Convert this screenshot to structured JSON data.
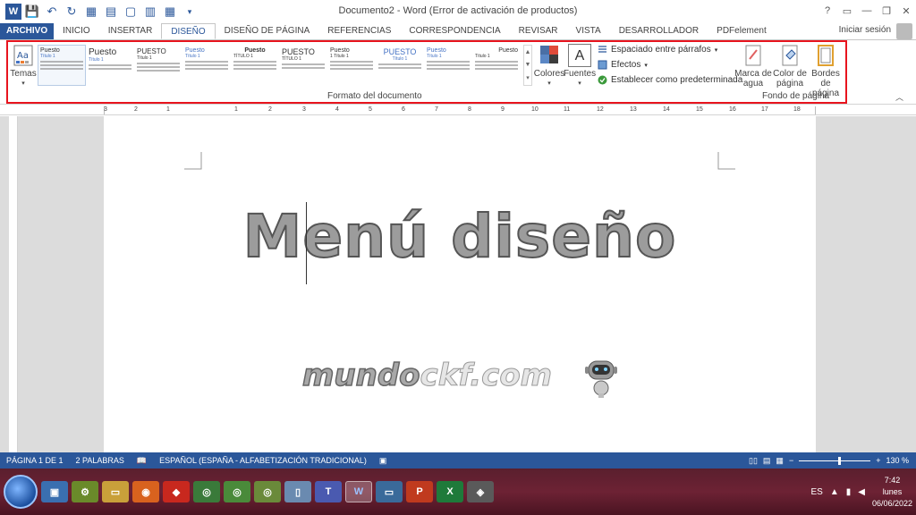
{
  "titlebar": {
    "doc_title": "Documento2 - Word (Error de activación de productos)",
    "help": "?",
    "controls": [
      "▭",
      "—",
      "❐",
      "✕"
    ]
  },
  "tabs": [
    "ARCHIVO",
    "INICIO",
    "INSERTAR",
    "DISEÑO",
    "DISEÑO DE PÁGINA",
    "REFERENCIAS",
    "CORRESPONDENCIA",
    "REVISAR",
    "VISTA",
    "DESARROLLADOR",
    "PDFelement"
  ],
  "active_tab": "DISEÑO",
  "signin": "Iniciar sesión",
  "ribbon": {
    "temas_label": "Temas",
    "style_thumbnails": [
      {
        "title": "Puesto",
        "heading": "Título 1"
      },
      {
        "title": "Puesto",
        "heading": "Título 1"
      },
      {
        "title": "PUESTO",
        "heading": "Título 1"
      },
      {
        "title": "Puesto",
        "heading": "Título 1"
      },
      {
        "title": "Puesto",
        "heading": "TÍTULO 1"
      },
      {
        "title": "PUESTO",
        "heading": "TÍTULO 1"
      },
      {
        "title": "Puesto",
        "heading": "1 Título 1"
      },
      {
        "title": "PUESTO",
        "heading": "Título 1"
      },
      {
        "title": "Puesto",
        "heading": "Título 1"
      },
      {
        "title": "Puesto",
        "heading": "Título 1"
      }
    ],
    "group_formato": "Formato del documento",
    "colores": "Colores",
    "fuentes": "Fuentes",
    "fuentes_glyph": "A",
    "espaciado": "Espaciado entre párrafos",
    "efectos": "Efectos",
    "establecer": "Establecer como predeterminada",
    "marca_de_agua": "Marca de agua",
    "color_de_pagina": "Color de página",
    "bordes_de_pagina": "Bordes de página",
    "group_fondo": "Fondo de página"
  },
  "ruler": {
    "numbers": [
      "3",
      "2",
      "1",
      "1",
      "2",
      "3",
      "4",
      "5",
      "6",
      "7",
      "8",
      "9",
      "10",
      "11",
      "12",
      "13",
      "14",
      "15",
      "16",
      "17",
      "18"
    ]
  },
  "document": {
    "title_text": "Menú diseño",
    "watermark_text_a": "mundo",
    "watermark_text_b": "ckf",
    "watermark_text_c": ".com"
  },
  "statusbar": {
    "page": "PÁGINA 1 DE 1",
    "words": "2 PALABRAS",
    "language": "ESPAÑOL (ESPAÑA - ALFABETIZACIÓN TRADICIONAL)",
    "zoom": "130 %",
    "zoom_level": 0.56
  },
  "taskbar": {
    "lang": "ES",
    "time": "7:42",
    "day": "lunes",
    "date": "06/06/2022"
  }
}
